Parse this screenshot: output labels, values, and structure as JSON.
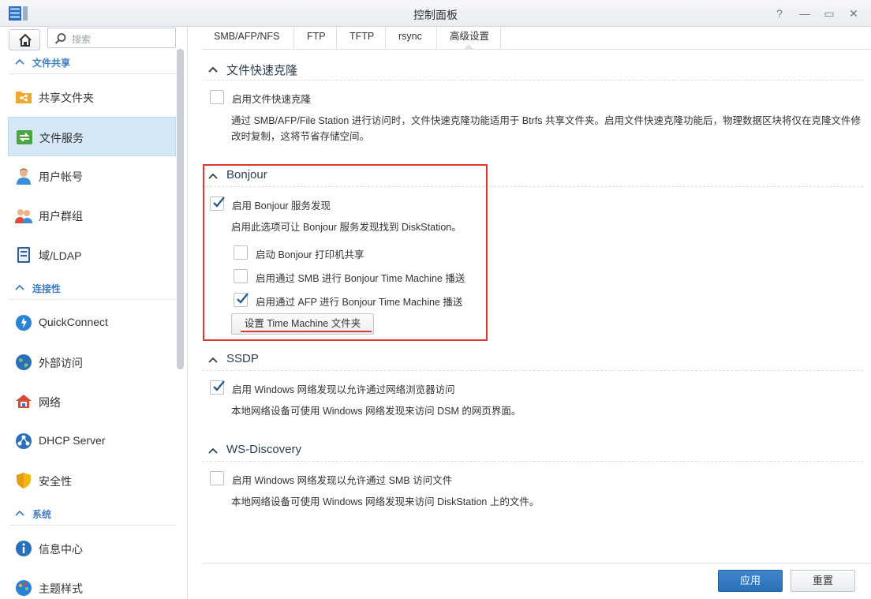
{
  "window": {
    "title": "控制面板",
    "controls": {
      "help": "?",
      "minimize": "—",
      "maximize": "▭",
      "close": "✕"
    }
  },
  "sidebar": {
    "search_placeholder": "搜索",
    "sections": [
      {
        "label": "文件共享"
      },
      {
        "label": "连接性"
      },
      {
        "label": "系统"
      }
    ],
    "items": [
      {
        "label": "共享文件夹",
        "icon": "shared-folder-icon"
      },
      {
        "label": "文件服务",
        "icon": "file-services-icon",
        "active": true
      },
      {
        "label": "用户帐号",
        "icon": "user-icon"
      },
      {
        "label": "用户群组",
        "icon": "group-icon"
      },
      {
        "label": "域/LDAP",
        "icon": "domain-ldap-icon"
      },
      {
        "label": "QuickConnect",
        "icon": "quickconnect-icon"
      },
      {
        "label": "外部访问",
        "icon": "external-access-icon"
      },
      {
        "label": "网络",
        "icon": "network-icon"
      },
      {
        "label": "DHCP Server",
        "icon": "dhcp-icon"
      },
      {
        "label": "安全性",
        "icon": "security-icon"
      },
      {
        "label": "信息中心",
        "icon": "info-center-icon"
      },
      {
        "label": "主题样式",
        "icon": "theme-icon"
      }
    ]
  },
  "tabs": [
    {
      "label": "SMB/AFP/NFS"
    },
    {
      "label": "FTP"
    },
    {
      "label": "TFTP"
    },
    {
      "label": "rsync"
    },
    {
      "label": "高级设置",
      "selected": true
    }
  ],
  "groups": {
    "fast_clone": {
      "title": "文件快速克隆",
      "checkbox": {
        "label": "启用文件快速克隆",
        "checked": false
      },
      "desc_line1": "通过 SMB/AFP/File Station 进行访问时，文件快速克隆功能适用于 Btrfs 共享文件夹。启用文件快速克隆功能后，物理数据区块将仅在克隆文件修",
      "desc_line2": "改时复制，这将节省存储空间。"
    },
    "bonjour": {
      "title": "Bonjour",
      "checkbox": {
        "label": "启用 Bonjour 服务发现",
        "checked": true
      },
      "desc": "启用此选项可让 Bonjour 服务发现找到 DiskStation。",
      "printer": {
        "label": "启动 Bonjour 打印机共享",
        "checked": false
      },
      "smb_tm": {
        "label": "启用通过 SMB 进行 Bonjour Time Machine 播送",
        "checked": false
      },
      "afp_tm": {
        "label": "启用通过 AFP 进行 Bonjour Time Machine 播送",
        "checked": true
      },
      "tm_button": "设置 Time Machine 文件夹"
    },
    "ssdp": {
      "title": "SSDP",
      "checkbox": {
        "label": "启用 Windows 网络发现以允许通过网络浏览器访问",
        "checked": true
      },
      "desc": "本地网络设备可使用 Windows 网络发现来访问 DSM 的网页界面。"
    },
    "ws_discovery": {
      "title": "WS-Discovery",
      "checkbox": {
        "label": "启用 Windows 网络发现以允许通过 SMB 访问文件",
        "checked": false
      },
      "desc": "本地网络设备可使用 Windows 网络发现来访问 DiskStation 上的文件。"
    }
  },
  "footer": {
    "apply": "应用",
    "reset": "重置"
  },
  "colors": {
    "accent": "#2c6fb7",
    "section_label": "#3e7fc1",
    "annotation": "#e0392b",
    "active_item": "#d6e7f7"
  }
}
